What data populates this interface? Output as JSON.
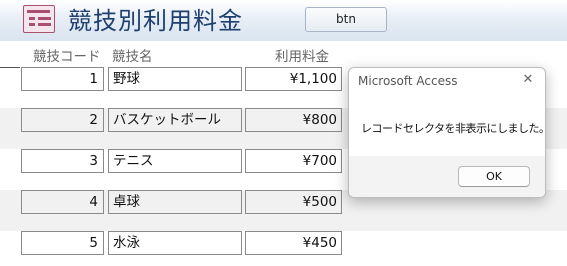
{
  "form": {
    "title": "競技別利用料金",
    "button_label": "btn"
  },
  "columns": {
    "code": "競技コード",
    "name": "競技名",
    "fee": "利用料金"
  },
  "rows": [
    {
      "code": "1",
      "name": "野球",
      "fee": "¥1,100"
    },
    {
      "code": "2",
      "name": "バスケットボール",
      "fee": "¥800"
    },
    {
      "code": "3",
      "name": "テニス",
      "fee": "¥700"
    },
    {
      "code": "4",
      "name": "卓球",
      "fee": "¥500"
    },
    {
      "code": "5",
      "name": "水泳",
      "fee": "¥450"
    }
  ],
  "dialog": {
    "title": "Microsoft Access",
    "close_glyph": "✕",
    "message": "レコードセレクタを非表示にしました。",
    "ok_label": "OK"
  }
}
